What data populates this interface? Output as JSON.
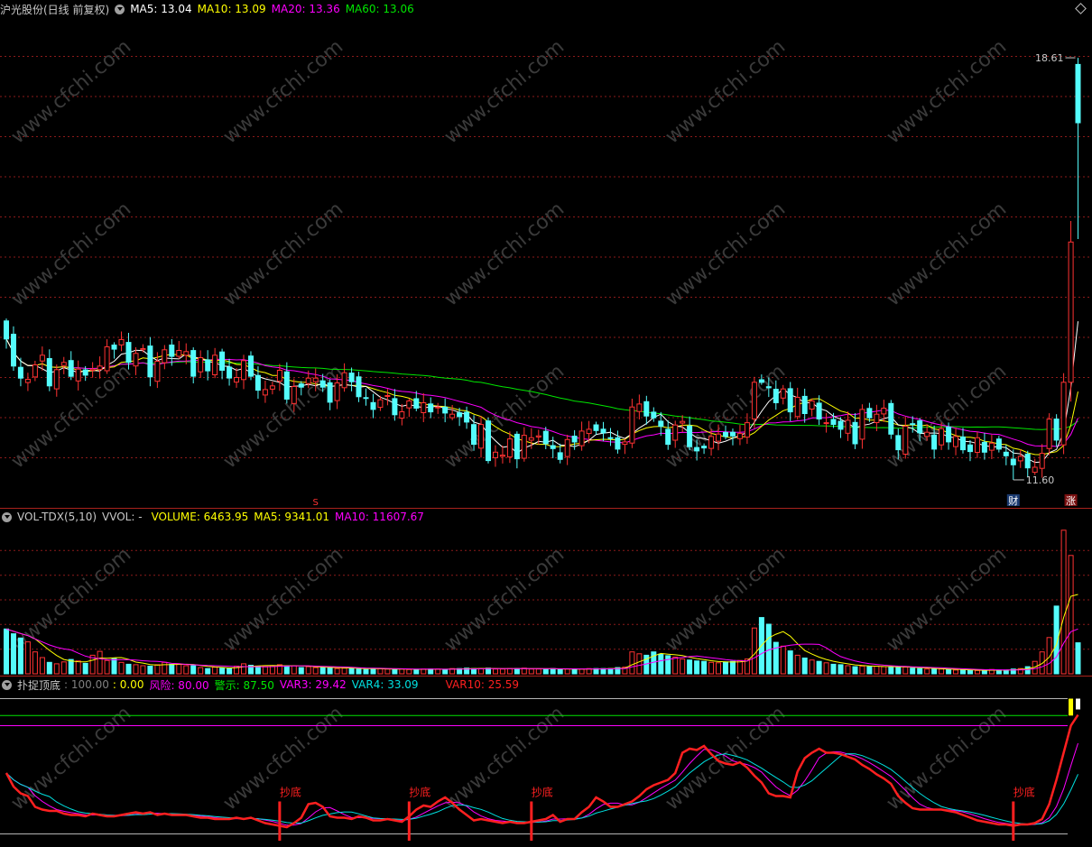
{
  "price_pane": {
    "title": "沪光股份(日线 前复权)",
    "ma5_text": "MA5: 13.04",
    "ma10_text": "MA10: 13.09",
    "ma20_text": "MA20: 13.36",
    "ma60_text": "MA60: 13.06",
    "high_label": "18.61",
    "low_label": "11.60",
    "marker_s": "S",
    "marker_cai": "财",
    "marker_zhang": "涨",
    "y_range": [
      11.3,
      19.3
    ],
    "high_value": 18.61,
    "low_value": 11.6
  },
  "volume_pane": {
    "title": "VOL-TDX(5,10)",
    "vvol_text": "VVOL: -",
    "volume_text": "VOLUME: 6463.95",
    "ma5_text": "MA5: 9341.01",
    "ma10_text": "MA10: 11607.67",
    "y_max": 31000
  },
  "indicator_pane": {
    "title": "扑捉顶底",
    "v1_text": ": 100.00",
    "v2_text": ": 0.00",
    "risk_text": "风险: 80.00",
    "warn_text": "警示: 87.50",
    "var3_text": "VAR3: 29.42",
    "var4_text": "VAR4: 33.09",
    "var10_text": "VAR10: 25.59",
    "signal_label": "抄底",
    "y_range": [
      -5,
      105
    ],
    "risk_level": 80,
    "warn_level": 87.5,
    "top_level": 100,
    "bottom_level": 0
  },
  "watermark": "www.cfchi.com",
  "colors": {
    "up": "#ff3232",
    "down": "#54fcfc",
    "ma5": "#ffffff",
    "ma10": "#ffff00",
    "ma20": "#ff00ff",
    "ma60": "#00e600",
    "grid": "#8c1a1a",
    "separator": "#a8221c",
    "var3": "#ff00ff",
    "var4": "#00e0e0",
    "var10": "#ff2020"
  },
  "chart_data": {
    "type": "candlestick",
    "sessions": 150,
    "close": [
      13.94,
      13.49,
      13.29,
      13.27,
      13.51,
      13.67,
      13.16,
      13.43,
      13.55,
      13.32,
      13.44,
      13.34,
      13.44,
      13.49,
      13.81,
      13.77,
      13.93,
      13.55,
      13.7,
      13.78,
      13.31,
      13.57,
      13.76,
      13.65,
      13.75,
      13.73,
      13.32,
      13.63,
      13.41,
      13.67,
      13.42,
      13.29,
      13.3,
      13.58,
      13.32,
      13.09,
      13.1,
      13.16,
      13.42,
      12.94,
      13.15,
      13.14,
      13.29,
      13.29,
      13.14,
      12.89,
      13.21,
      13.38,
      13.23,
      12.98,
      12.96,
      12.77,
      12.93,
      13.0,
      12.68,
      12.73,
      12.91,
      12.79,
      12.88,
      12.73,
      12.81,
      12.71,
      12.69,
      12.65,
      12.56,
      12.19,
      12.52,
      11.92,
      12.06,
      12.01,
      12.28,
      11.95,
      12.34,
      12.3,
      12.33,
      12.2,
      12.12,
      11.94,
      12.27,
      12.23,
      12.41,
      12.44,
      12.42,
      12.38,
      12.3,
      12.11,
      12.23,
      12.81,
      12.86,
      12.66,
      12.63,
      12.49,
      12.19,
      12.51,
      12.57,
      12.15,
      12.08,
      12.13,
      12.32,
      12.36,
      12.32,
      12.33,
      12.37,
      12.55,
      13.22,
      13.22,
      13.13,
      12.88,
      13.11,
      12.73,
      12.97,
      12.7,
      12.91,
      12.61,
      12.55,
      12.52,
      12.44,
      12.59,
      12.2,
      12.77,
      12.63,
      12.69,
      12.79,
      12.36,
      12.1,
      12.49,
      12.52,
      12.38,
      12.39,
      12.11,
      12.45,
      12.23,
      12.32,
      12.1,
      12.07,
      12.3,
      12.06,
      12.21,
      12.11,
      12.0,
      11.85,
      11.99,
      11.8,
      11.81,
      12.04,
      12.61,
      12.26,
      13.22,
      15.55,
      17.53
    ],
    "volume": [
      9400,
      8400,
      7500,
      6700,
      4600,
      3400,
      2400,
      2100,
      2500,
      3000,
      2700,
      2200,
      3900,
      4700,
      2800,
      3200,
      2400,
      2000,
      1900,
      1700,
      1600,
      1900,
      2400,
      2000,
      2000,
      1700,
      1700,
      1300,
      1100,
      1400,
      1200,
      1100,
      1600,
      2100,
      1800,
      1600,
      1500,
      1700,
      1900,
      1700,
      1700,
      1300,
      1500,
      1300,
      1300,
      1300,
      1100,
      1200,
      1200,
      1000,
      900,
      1100,
      1100,
      1000,
      900,
      1000,
      900,
      900,
      1000,
      1000,
      1000,
      900,
      1100,
      1100,
      1200,
      1100,
      1100,
      1200,
      1000,
      1000,
      1100,
      1100,
      1200,
      1000,
      1000,
      1000,
      1100,
      1000,
      1000,
      900,
      1000,
      1100,
      1100,
      1100,
      1100,
      1300,
      1400,
      4600,
      4200,
      3900,
      4600,
      4100,
      3800,
      3500,
      3100,
      2900,
      2700,
      2600,
      2400,
      2300,
      2500,
      2600,
      2800,
      3100,
      9600,
      11800,
      10400,
      6600,
      5800,
      4800,
      3900,
      3300,
      2900,
      2600,
      2300,
      2000,
      1900,
      1700,
      1500,
      1600,
      1500,
      1600,
      1500,
      1400,
      1400,
      1400,
      1200,
      1100,
      1000,
      1000,
      1000,
      900,
      800,
      800,
      700,
      700,
      700,
      900,
      800,
      800,
      1000,
      1100,
      1500,
      2600,
      4600,
      7600,
      14200,
      30100,
      24800,
      6500
    ],
    "var10": [
      45,
      35,
      30,
      28,
      20,
      18,
      17,
      17,
      15,
      14,
      14,
      13,
      15,
      14,
      13,
      13,
      14,
      15,
      16,
      15,
      16,
      14,
      15,
      14,
      14,
      14,
      13,
      12,
      12,
      11,
      11,
      11,
      12,
      11,
      12,
      10,
      8,
      7,
      6,
      5,
      8,
      12,
      22,
      23,
      20,
      13,
      12,
      12,
      11,
      13,
      12,
      10,
      10,
      11,
      10,
      9,
      13,
      18,
      21,
      20,
      24,
      27,
      23,
      18,
      14,
      10,
      11,
      10,
      9,
      8,
      9,
      8,
      8,
      9,
      10,
      11,
      14,
      9,
      11,
      11,
      16,
      20,
      27,
      24,
      20,
      20,
      22,
      24,
      28,
      33,
      36,
      38,
      40,
      45,
      60,
      63,
      62,
      65,
      59,
      54,
      52,
      51,
      53,
      49,
      43,
      38,
      30,
      28,
      28,
      27,
      46,
      56,
      60,
      63,
      60,
      60,
      59,
      57,
      55,
      51,
      48,
      44,
      41,
      37,
      28,
      23,
      19,
      18,
      18,
      18,
      18,
      17,
      16,
      14,
      12,
      10,
      9,
      8,
      7,
      7,
      6,
      7,
      7,
      8,
      11,
      22,
      40,
      60,
      80,
      88
    ]
  }
}
